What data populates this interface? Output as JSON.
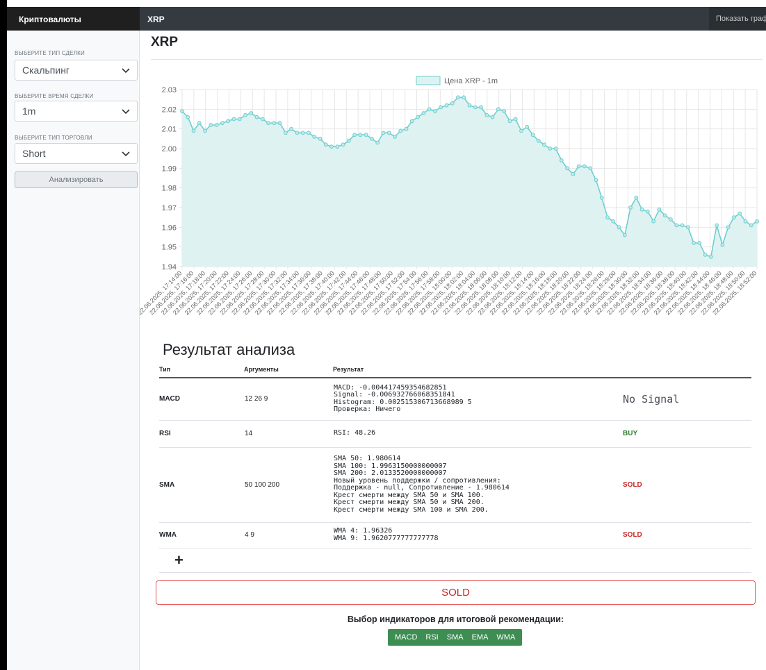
{
  "sidebar": {
    "header": "Криптовалюты",
    "deal_type": {
      "label": "ВЫБЕРИТЕ ТИП СДЕЛКИ",
      "value": "Скальпинг"
    },
    "deal_time": {
      "label": "ВЫБЕРИТЕ ВРЕМЯ СДЕЛКИ",
      "value": "1m"
    },
    "trade_type": {
      "label": "ВЫБЕРИТЕ ТИП ТОРГОВЛИ",
      "value": "Short"
    },
    "analyze_button": "Анализировать"
  },
  "topbar": {
    "brand": "XRP",
    "show_chart": "Показать график"
  },
  "page": {
    "title": "XRP"
  },
  "chart_data": {
    "type": "area",
    "legend": "Цена XRP - 1m",
    "ylim": [
      1.94,
      2.03
    ],
    "yticks": [
      2.03,
      2.02,
      2.01,
      2.0,
      1.99,
      1.98,
      1.97,
      1.96,
      1.95,
      1.94
    ],
    "ytick_labels": [
      "2.03",
      "2.02",
      "2.01",
      "2.00",
      "1.99",
      "1.98",
      "1.97",
      "1.96",
      "1.95",
      "1.94"
    ],
    "x_labels": [
      "22.06.2025, 17:14:00",
      "22.06.2025, 17:16:00",
      "22.06.2025, 17:18:00",
      "22.06.2025, 17:20:00",
      "22.06.2025, 17:22:00",
      "22.06.2025, 17:24:00",
      "22.06.2025, 17:26:00",
      "22.06.2025, 17:28:00",
      "22.06.2025, 17:30:00",
      "22.06.2025, 17:32:00",
      "22.06.2025, 17:34:00",
      "22.06.2025, 17:36:00",
      "22.06.2025, 17:38:00",
      "22.06.2025, 17:40:00",
      "22.06.2025, 17:42:00",
      "22.06.2025, 17:44:00",
      "22.06.2025, 17:46:00",
      "22.06.2025, 17:48:00",
      "22.06.2025, 17:50:00",
      "22.06.2025, 17:52:00",
      "22.06.2025, 17:54:00",
      "22.06.2025, 17:56:00",
      "22.06.2025, 17:58:00",
      "22.06.2025, 18:00:00",
      "22.06.2025, 18:02:00",
      "22.06.2025, 18:04:00",
      "22.06.2025, 18:06:00",
      "22.06.2025, 18:08:00",
      "22.06.2025, 18:10:00",
      "22.06.2025, 18:12:00",
      "22.06.2025, 18:14:00",
      "22.06.2025, 18:16:00",
      "22.06.2025, 18:18:00",
      "22.06.2025, 18:20:00",
      "22.06.2025, 18:22:00",
      "22.06.2025, 18:24:00",
      "22.06.2025, 18:26:00",
      "22.06.2025, 18:28:00",
      "22.06.2025, 18:30:00",
      "22.06.2025, 18:32:00",
      "22.06.2025, 18:34:00",
      "22.06.2025, 18:36:00",
      "22.06.2025, 18:38:00",
      "22.06.2025, 18:40:00",
      "22.06.2025, 18:42:00",
      "22.06.2025, 18:44:00",
      "22.06.2025, 18:46:00",
      "22.06.2025, 18:48:00",
      "22.06.2025, 18:50:00",
      "22.06.2025, 18:52:00"
    ],
    "values": [
      2.019,
      2.016,
      2.009,
      2.013,
      2.009,
      2.012,
      2.012,
      2.013,
      2.014,
      2.015,
      2.015,
      2.017,
      2.018,
      2.016,
      2.015,
      2.013,
      2.013,
      2.013,
      2.008,
      2.01,
      2.008,
      2.008,
      2.008,
      2.006,
      2.005,
      2.002,
      2.001,
      2.001,
      2.002,
      2.004,
      2.007,
      2.007,
      2.007,
      2.005,
      2.003,
      2.008,
      2.008,
      2.006,
      2.009,
      2.01,
      2.014,
      2.016,
      2.018,
      2.02,
      2.019,
      2.021,
      2.022,
      2.023,
      2.026,
      2.026,
      2.022,
      2.021,
      2.021,
      2.017,
      2.016,
      2.02,
      2.019,
      2.014,
      2.015,
      2.009,
      2.011,
      2.007,
      2.004,
      2.002,
      2.0,
      2.0,
      1.994,
      1.99,
      1.987,
      1.991,
      1.991,
      1.99,
      1.984,
      1.975,
      1.965,
      1.963,
      1.96,
      1.956,
      1.97,
      1.975,
      1.969,
      1.968,
      1.963,
      1.969,
      1.966,
      1.964,
      1.961,
      1.961,
      1.96,
      1.952,
      1.952,
      1.946,
      1.945,
      1.961,
      1.951,
      1.96,
      1.965,
      1.967,
      1.963,
      1.961,
      1.963
    ],
    "colors": {
      "line": "#6ccfcf",
      "fill": "#dff2f2",
      "point_fill": "#bfe9e9",
      "grid": "#e6e6e6"
    }
  },
  "results": {
    "title": "Результат анализа",
    "headers": {
      "type": "Тип",
      "args": "Аргументы",
      "result": "Результат"
    },
    "rows": [
      {
        "name": "MACD",
        "args": "12 26 9",
        "result": "MACD: -0.004417459354682851\nSignal: -0.006932766068351841\nHistogram: 0.002515306713668989 5\nПроверка: Ничего",
        "signal": "No Signal"
      },
      {
        "name": "RSI",
        "args": "14",
        "result": "RSI: 48.26",
        "signal": "BUY"
      },
      {
        "name": "SMA",
        "args": "50 100 200",
        "result": "SMA 50: 1.980614\nSMA 100: 1.9963150000000007\nSMA 200: 2.0133520000000007\nНовый уровень поддержки / сопротивления:\nПоддержка - null, Сопротивление - 1.980614\nКрест смерти между SMA 50 и SMA 100.\nКрест смерти между SMA 50 и SMA 200.\nКрест смерти между SMA 100 и SMA 200.",
        "signal": "SOLD"
      },
      {
        "name": "WMA",
        "args": "4 9",
        "result": "WMA 4: 1.96326\nWMA 9: 1.9620777777777778",
        "signal": "SOLD"
      }
    ],
    "add_label": "+"
  },
  "final": {
    "signal": "SOLD"
  },
  "indicators": {
    "title": "Выбор индикаторов для итоговой рекомендации:",
    "items": [
      "MACD",
      "RSI",
      "SMA",
      "EMA",
      "WMA"
    ]
  }
}
